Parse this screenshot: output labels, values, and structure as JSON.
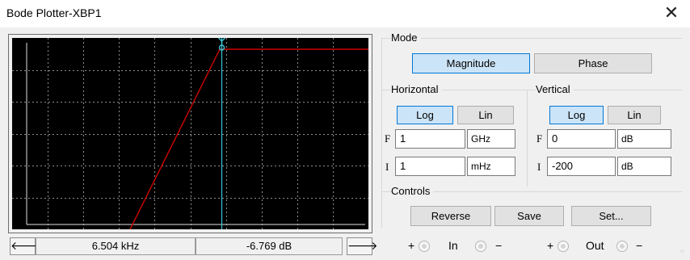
{
  "window": {
    "title": "Bode Plotter-XBP1",
    "close_symbol": "✕"
  },
  "plot": {
    "background": "#000000",
    "grid_color": "#8c8c8c",
    "trace_color": "#d00000",
    "cursor_color": "#39c6d6",
    "trace_shape": "flat top with rising slope on left",
    "grid_style": "dotted"
  },
  "navigation": {
    "left_arrow": "🡐",
    "right_arrow": "🡒",
    "frequency_readout": "6.504 kHz",
    "magnitude_readout": "-6.769 dB"
  },
  "mode": {
    "label": "Mode",
    "magnitude_label": "Magnitude",
    "phase_label": "Phase",
    "selected": "Magnitude"
  },
  "horizontal": {
    "label": "Horizontal",
    "log_label": "Log",
    "lin_label": "Lin",
    "selected": "Log",
    "final_label": "F",
    "final_value": "1",
    "final_unit": "GHz",
    "initial_label": "I",
    "initial_value": "1",
    "initial_unit": "mHz"
  },
  "vertical": {
    "label": "Vertical",
    "log_label": "Log",
    "lin_label": "Lin",
    "selected": "Log",
    "final_label": "F",
    "final_value": "0",
    "final_unit": "dB",
    "initial_label": "I",
    "initial_value": "-200",
    "initial_unit": "dB"
  },
  "controls": {
    "label": "Controls",
    "reverse_label": "Reverse",
    "save_label": "Save",
    "set_label": "Set..."
  },
  "terminals": {
    "in_plus": "+",
    "in_label": "In",
    "in_minus": "−",
    "out_plus": "+",
    "out_label": "Out",
    "out_minus": "−"
  }
}
